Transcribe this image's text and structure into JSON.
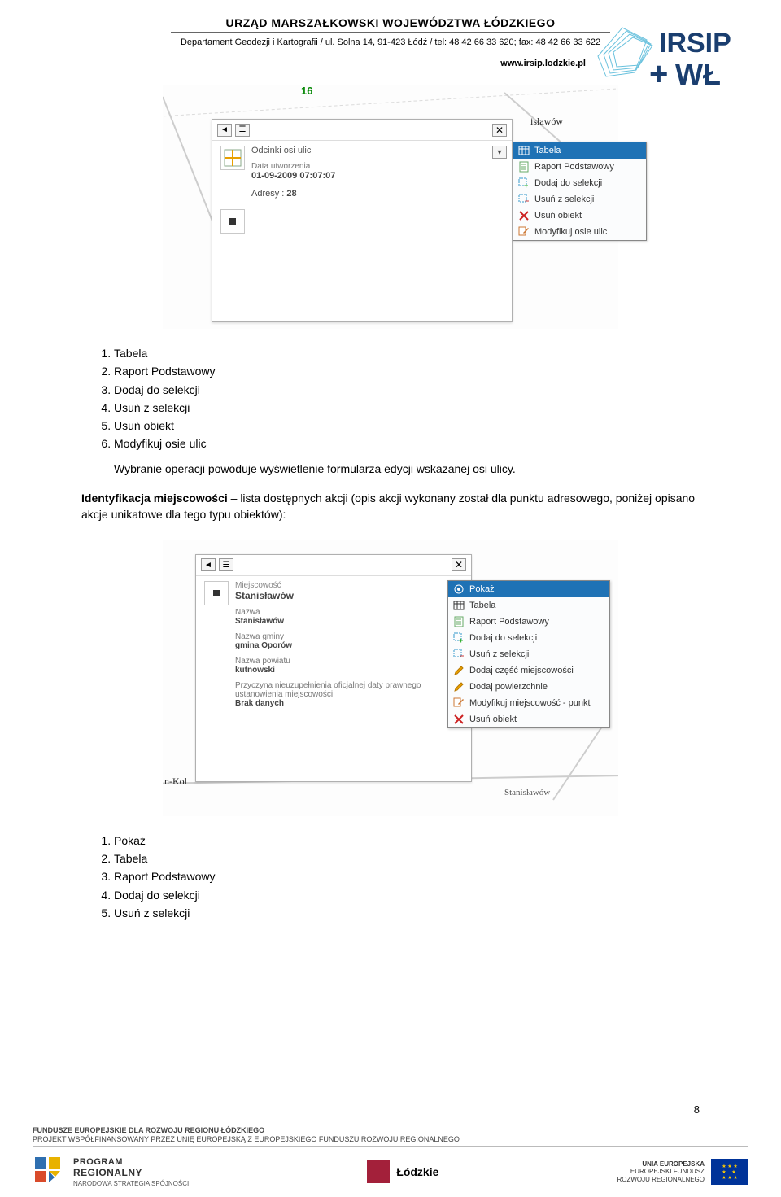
{
  "header": {
    "title": "URZĄD MARSZAŁKOWSKI WOJEWÓDZTWA ŁÓDZKIEGO",
    "subtitle": "Departament Geodezji i Kartografii / ul. Solna 14,  91-423 Łódź / tel: 48 42 66 33 620; fax: 48 42 66 33 622",
    "website": "www.irsip.lodzkie.pl",
    "logo_text_1": "IRSIP",
    "logo_text_2": "WŁ"
  },
  "screenshot1": {
    "number_label": "16",
    "bg_label": "isławów",
    "popup": {
      "row1_title": "Odcinki osi ulic",
      "row1_label": "Data utworzenia",
      "row1_value": "01-09-2009 07:07:07",
      "row2_label": "Adresy :",
      "row2_value": "28"
    },
    "menu": [
      {
        "icon": "table",
        "label": "Tabela",
        "hl": true
      },
      {
        "icon": "report",
        "label": "Raport Podstawowy"
      },
      {
        "icon": "add-sel",
        "label": "Dodaj do selekcji"
      },
      {
        "icon": "rem-sel",
        "label": "Usuń z selekcji"
      },
      {
        "icon": "delete",
        "label": "Usuń obiekt"
      },
      {
        "icon": "edit",
        "label": "Modyfikuj osie ulic"
      }
    ]
  },
  "list1": {
    "items": [
      "Tabela",
      "Raport Podstawowy",
      "Dodaj do selekcji",
      "Usuń z selekcji",
      "Usuń obiekt",
      "Modyfikuj osie ulic"
    ],
    "after_text": "Wybranie operacji powoduje wyświetlenie formularza edycji wskazanej osi ulicy."
  },
  "para2": {
    "lead": "Identyfikacja miejscowości",
    "rest": " – lista dostępnych akcji (opis akcji wykonany został dla punktu adresowego, poniżej opisano akcje unikatowe dla tego typu obiektów):"
  },
  "screenshot2": {
    "bg_label_left": "n-Kol",
    "bg_label_right": "Stanisławów",
    "popup": {
      "row_title": "Miejscowość",
      "row_title_val": "Stanisławów",
      "f1_label": "Nazwa",
      "f1_val": "Stanisławów",
      "f2_label": "Nazwa gminy",
      "f2_val": "gmina Oporów",
      "f3_label": "Nazwa powiatu",
      "f3_val": "kutnowski",
      "f4_label": "Przyczyna nieuzupełnienia oficjalnej daty prawnego ustanowienia miejscowości",
      "f4_val": "Brak danych"
    },
    "menu": [
      {
        "icon": "show",
        "label": "Pokaż",
        "hl": true
      },
      {
        "icon": "table",
        "label": "Tabela"
      },
      {
        "icon": "report",
        "label": "Raport Podstawowy"
      },
      {
        "icon": "add-sel",
        "label": "Dodaj do selekcji"
      },
      {
        "icon": "rem-sel",
        "label": "Usuń z selekcji"
      },
      {
        "icon": "pencil",
        "label": "Dodaj część miejscowości"
      },
      {
        "icon": "pencil",
        "label": "Dodaj powierzchnie"
      },
      {
        "icon": "edit",
        "label": "Modyfikuj miejscowość - punkt"
      },
      {
        "icon": "delete",
        "label": "Usuń obiekt"
      }
    ]
  },
  "list2": {
    "items": [
      "Pokaż",
      "Tabela",
      "Raport Podstawowy",
      "Dodaj do selekcji",
      "Usuń z selekcji"
    ]
  },
  "page_number": "8",
  "footer": {
    "line1": "FUNDUSZE EUROPEJSKIE DLA ROZWOJU REGIONU ŁÓDZKIEGO",
    "line2": "PROJEKT WSPÓŁFINANSOWANY PRZEZ UNIĘ EUROPEJSKĄ Z EUROPEJSKIEGO FUNDUSZU ROZWOJU REGIONALNEGO",
    "prog1": "PROGRAM",
    "prog2": "REGIONALNY",
    "prog3": "NARODOWA STRATEGIA SPÓJNOŚCI",
    "lodzkie": "Łódzkie",
    "eu1": "UNIA EUROPEJSKA",
    "eu2": "EUROPEJSKI FUNDUSZ",
    "eu3": "ROZWOJU REGIONALNEGO"
  }
}
